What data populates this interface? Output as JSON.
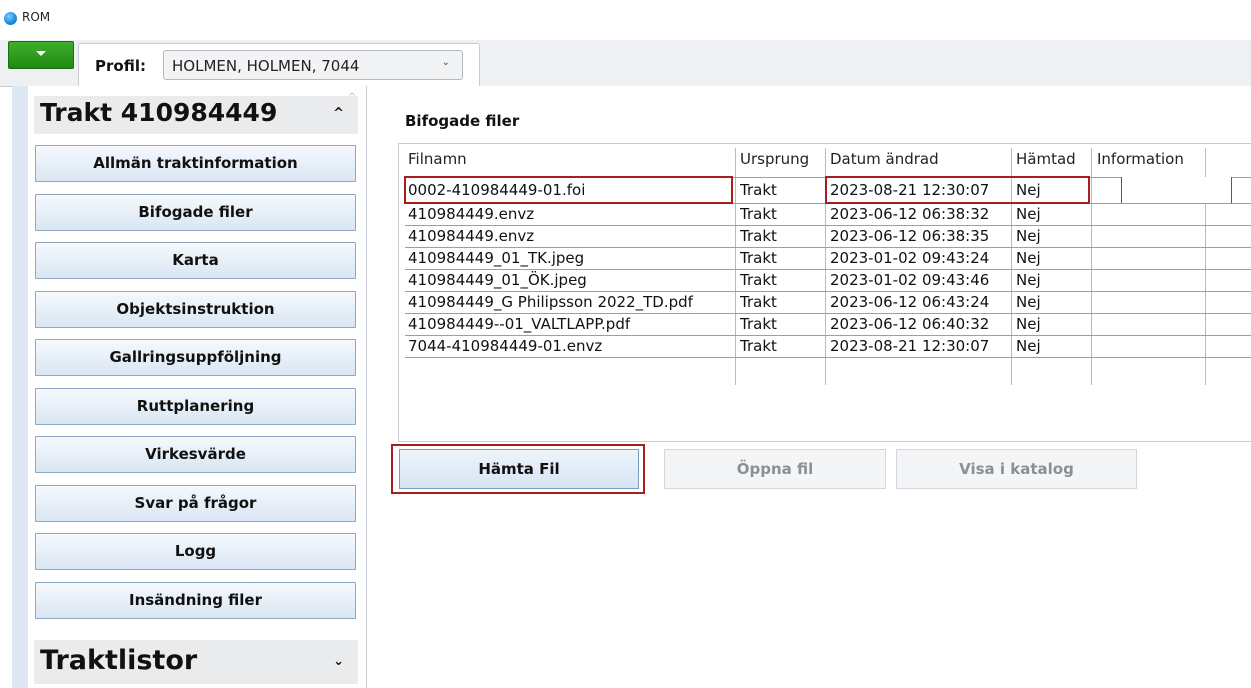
{
  "window": {
    "title": "ROM"
  },
  "toolbar": {
    "profile_label": "Profil:",
    "profile_value": "HOLMEN, HOLMEN, 7044"
  },
  "sidebar": {
    "header": "Trakt 410984449",
    "items": [
      "Allmän traktinformation",
      "Bifogade filer",
      "Karta",
      "Objektsinstruktion",
      "Gallringsuppföljning",
      "Ruttplanering",
      "Virkesvärde",
      "Svar på frågor",
      "Logg",
      "Insändning filer"
    ],
    "footer": "Traktlistor"
  },
  "main": {
    "section_title": "Bifogade filer",
    "columns": [
      "Filnamn",
      "Ursprung",
      "Datum ändrad",
      "Hämtad",
      "Information"
    ],
    "rows": [
      [
        "0002-410984449-01.foi",
        "Trakt",
        "2023-08-21 12:30:07",
        "Nej",
        ""
      ],
      [
        "410984449.envz",
        "Trakt",
        "2023-06-12 06:38:32",
        "Nej",
        ""
      ],
      [
        "410984449.envz",
        "Trakt",
        "2023-06-12 06:38:35",
        "Nej",
        ""
      ],
      [
        "410984449_01_TK.jpeg",
        "Trakt",
        "2023-01-02 09:43:24",
        "Nej",
        ""
      ],
      [
        "410984449_01_ÖK.jpeg",
        "Trakt",
        "2023-01-02 09:43:46",
        "Nej",
        ""
      ],
      [
        "410984449_G Philipsson 2022_TD.pdf",
        "Trakt",
        "2023-06-12 06:43:24",
        "Nej",
        ""
      ],
      [
        "410984449--01_VALTLAPP.pdf",
        "Trakt",
        "2023-06-12 06:40:32",
        "Nej",
        ""
      ],
      [
        "7044-410984449-01.envz",
        "Trakt",
        "2023-08-21 12:30:07",
        "Nej",
        ""
      ]
    ],
    "buttons": {
      "fetch": "Hämta Fil",
      "open": "Öppna fil",
      "show_in_folder": "Visa i katalog"
    }
  },
  "colors": {
    "highlight": "#a81d1d",
    "accent_green": "#2a9a1a",
    "button_border": "#8fa7c0"
  }
}
